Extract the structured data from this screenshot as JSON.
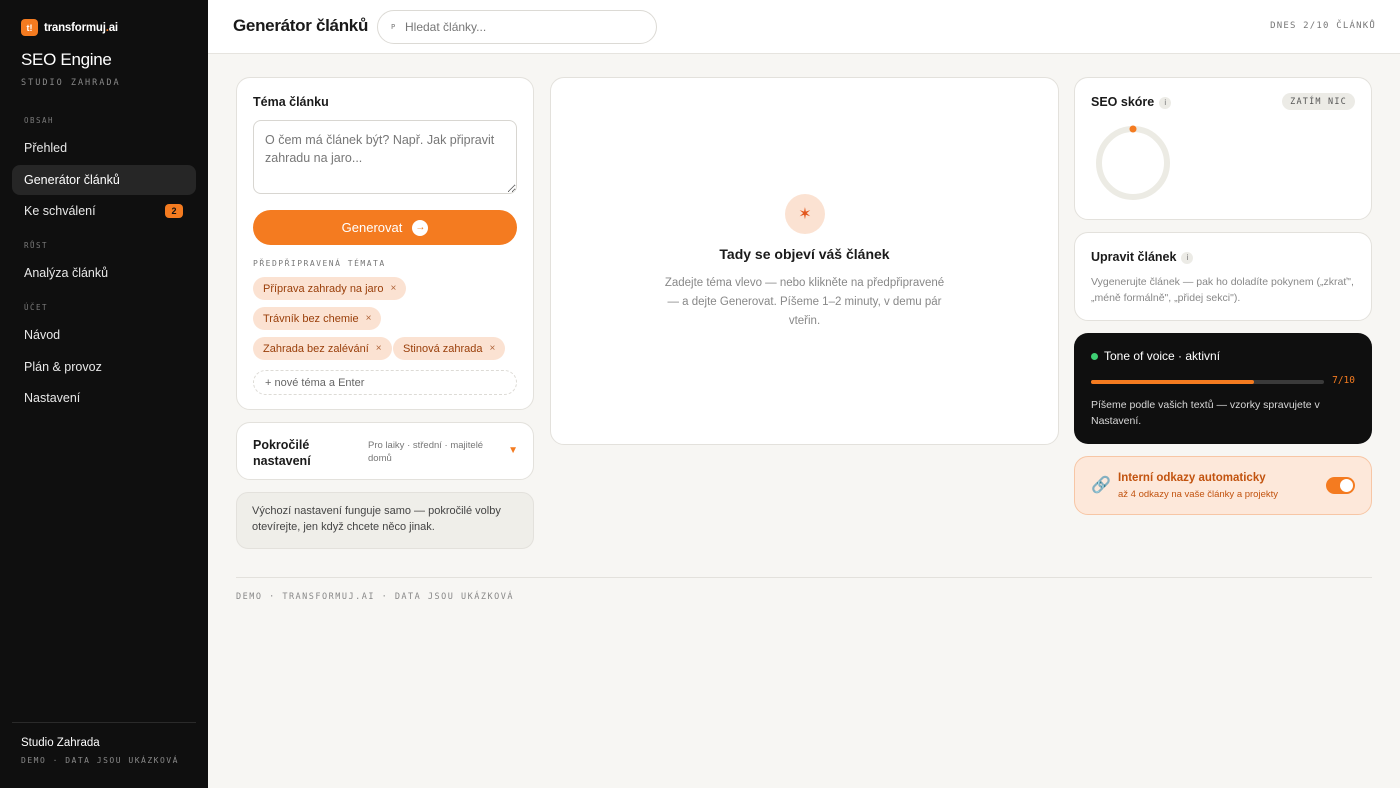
{
  "sidebar": {
    "brand_logo": "t!",
    "brand_name_a": "transformuj",
    "brand_name_b": ".",
    "brand_name_c": "ai",
    "app_title": "SEO Engine",
    "app_subtitle": "STUDIO ZAHRADA",
    "sections": [
      {
        "label": "OBSAH"
      },
      {
        "label": "RŮST"
      },
      {
        "label": "ÚČET"
      }
    ],
    "items": [
      {
        "label": "Přehled"
      },
      {
        "label": "Generátor článků",
        "active": true
      },
      {
        "label": "Ke schválení",
        "badge": "2"
      },
      {
        "label": "Analýza článků"
      },
      {
        "label": "Návod"
      },
      {
        "label": "Plán & provoz"
      },
      {
        "label": "Nastavení"
      }
    ],
    "footer_name": "Studio Zahrada",
    "footer_note": "DEMO · DATA JSOU UKÁZKOVÁ"
  },
  "header": {
    "title": "Generátor článků",
    "search_icon_glyph": "P",
    "search_placeholder": "Hledat články...",
    "quota": "DNES 2/10 ČLÁNKŮ"
  },
  "topic": {
    "title": "Téma článku",
    "placeholder": "O čem má článek být? Např. Jak připravit zahradu na jaro...",
    "generate_label": "Generovat",
    "generate_icon": "→",
    "presets_label": "PŘEDPŘIPRAVENÁ TÉMATA",
    "presets": [
      {
        "label": "Příprava zahrady na jaro"
      },
      {
        "label": "Trávník bez chemie"
      },
      {
        "label": "Zahrada bez zalévání"
      },
      {
        "label": "Stinová zahrada"
      }
    ],
    "chip_remove": "×",
    "new_topic_placeholder": "+ nové téma a Enter"
  },
  "advanced": {
    "title": "Pokročilé nastavení",
    "desc": "Pro laiky · střední · majitelé domů",
    "chevron": "▼"
  },
  "note": "Výchozí nastavení funguje samo — pokročilé volby otevírejte, jen když chcete něco jinak.",
  "preview": {
    "icon": "✶",
    "title": "Tady se objeví váš článek",
    "text": "Zadejte téma vlevo — nebo klikněte na předpřipravené — a dejte Generovat. Píšeme 1–2 minuty, v demu pár vteřin."
  },
  "seo": {
    "title": "SEO skóre",
    "info": "i",
    "badge": "ZATÍM NIC",
    "score_fraction": 0
  },
  "edit": {
    "title": "Upravit článek",
    "info": "i",
    "desc": "Vygenerujte článek — pak ho doladíte pokynem („zkrať\", „méně formálně\", „přidej sekci\")."
  },
  "tone": {
    "title": "Tone of voice · aktivní",
    "value_label": "7/10",
    "fraction": 0.7,
    "desc": "Píšeme podle vašich textů — vzorky spravujete v Nastavení."
  },
  "links": {
    "icon": "🔗",
    "title": "Interní odkazy automaticky",
    "desc": "až 4 odkazy na vaše články a projekty",
    "enabled": true
  },
  "footer": "DEMO · TRANSFORMUJ.AI · DATA JSOU UKÁZKOVÁ",
  "colors": {
    "accent": "#f47b20",
    "sidebar_bg": "#0f0f0f",
    "chip_bg": "#fbe2d2",
    "status_green": "#3ecf73"
  }
}
